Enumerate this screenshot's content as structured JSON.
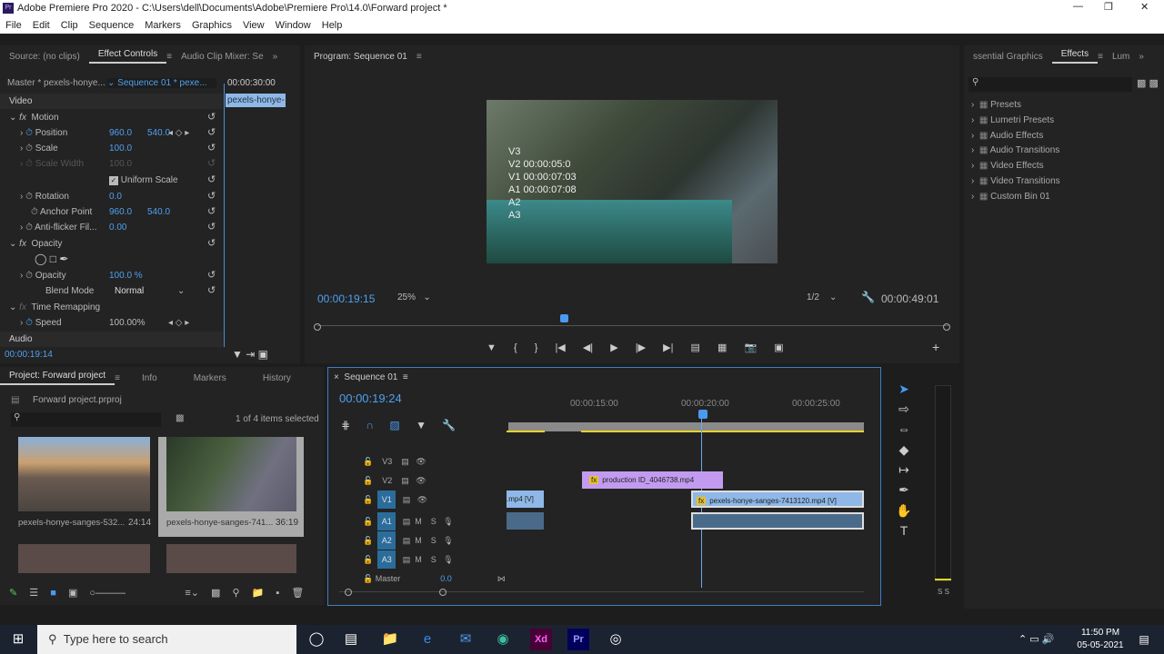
{
  "window": {
    "title": "Adobe Premiere Pro 2020 - C:\\Users\\dell\\Documents\\Adobe\\Premiere Pro\\14.0\\Forward project *",
    "app_badge": "Pr"
  },
  "menu": [
    "File",
    "Edit",
    "Clip",
    "Sequence",
    "Markers",
    "Graphics",
    "View",
    "Window",
    "Help"
  ],
  "watermark": "RRCG 人人素材",
  "effect_controls": {
    "tabs": [
      "Source: (no clips)",
      "Effect Controls",
      "Audio Clip Mixer: Se"
    ],
    "master": "Master * pexels-honye...",
    "sequence": "Sequence 01 * pexe...",
    "mini_time": "00:00:30:00",
    "mini_clip": "pexels-honye-s",
    "section_video": "Video",
    "section_audio": "Audio",
    "motion": "Motion",
    "params": [
      {
        "name": "Position",
        "v1": "960.0",
        "v2": "540.0"
      },
      {
        "name": "Scale",
        "v1": "100.0"
      },
      {
        "name": "Scale Width",
        "v1": "100.0"
      },
      {
        "name": "Rotation",
        "v1": "0.0"
      },
      {
        "name": "Anchor Point",
        "v1": "960.0",
        "v2": "540.0"
      },
      {
        "name": "Anti-flicker Fil...",
        "v1": "0.00"
      }
    ],
    "uniform_scale": "Uniform Scale",
    "uniform_scale_checked": true,
    "opacity": "Opacity",
    "opacity_param": "Opacity",
    "opacity_value": "100.0 %",
    "blend_mode": "Blend Mode",
    "blend_value": "Normal",
    "time_remapping": "Time Remapping",
    "speed": "Speed",
    "speed_value": "100.00%",
    "timecode": "00:00:19:14"
  },
  "program": {
    "tab": "Program: Sequence 01",
    "overlay": [
      "V3",
      "V2 00:00:05:0",
      "V1 00:00:07:03",
      "A1 00:00:07:08",
      "A2",
      "A3"
    ],
    "timecode": "00:00:19:15",
    "zoom": "25%",
    "resolution": "1/2",
    "duration": "00:00:49:01",
    "playhead_fraction": 0.39
  },
  "effects": {
    "tabs": [
      "ssential Graphics",
      "Effects",
      "Lum"
    ],
    "items": [
      "Presets",
      "Lumetri Presets",
      "Audio Effects",
      "Audio Transitions",
      "Video Effects",
      "Video Transitions",
      "Custom Bin 01"
    ]
  },
  "project": {
    "tabs": [
      "Project: Forward project",
      "Info",
      "Markers",
      "History"
    ],
    "file": "Forward project.prproj",
    "selection": "1 of 4 items selected",
    "clips": [
      {
        "name": "pexels-honye-sanges-532...",
        "duration": "24:14"
      },
      {
        "name": "pexels-honye-sanges-741...",
        "duration": "36:19"
      }
    ]
  },
  "timeline": {
    "tab": "Sequence 01",
    "timecode": "00:00:19:24",
    "ruler": [
      "00:00:15:00",
      "00:00:20:00",
      "00:00:25:00"
    ],
    "video_tracks": [
      "V3",
      "V2",
      "V1"
    ],
    "audio_tracks": [
      "A1",
      "A2",
      "A3"
    ],
    "mute": "M",
    "solo": "S",
    "master": "Master",
    "master_value": "0.0",
    "clips": {
      "v2": "production ID_4046738.mp4",
      "v1_left": ".mp4 [V]",
      "v1_right": "pexels-honye-sanges-7413120.mp4 [V]"
    }
  },
  "meters": {
    "labels": [
      "S",
      "S"
    ]
  },
  "taskbar": {
    "search": "Type here to search",
    "time": "11:50 PM",
    "date": "05-05-2021"
  }
}
